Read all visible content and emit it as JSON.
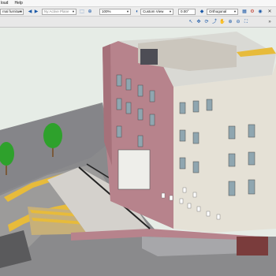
{
  "menu": {
    "items": [
      "loud",
      "Help"
    ]
  },
  "toolbar": {
    "class_field": "rnal furniture",
    "layer_field": "Ny Active Plane",
    "zoom_field": "100%",
    "view_field": "Custom View",
    "angle_field": "0.00°",
    "projection_field": "Orthogonal"
  },
  "colors": {
    "brick": "#b7838c",
    "stone": "#e5e1d6",
    "roof": "#d9d9d4",
    "ground": "#8a8a8c",
    "grass": "#e6ece6",
    "paving_highlight": "#e7bb3b",
    "tree": "#2ea12c"
  },
  "icons": [
    "back-icon",
    "forward-icon",
    "layer-icon",
    "zoom-icon",
    "view-icon",
    "render-icon",
    "grid-icon",
    "settings-icon"
  ]
}
